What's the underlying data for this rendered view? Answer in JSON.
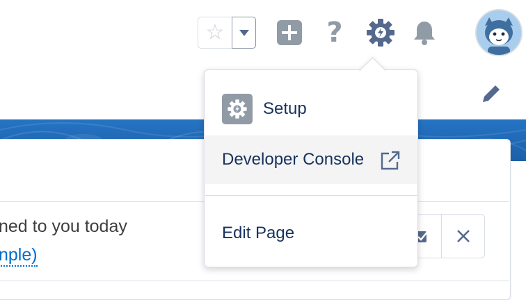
{
  "header": {
    "favorites_star_glyph": "☆",
    "icons": [
      "favorites-star-icon",
      "favorites-dropdown-icon",
      "plus-icon",
      "help-icon",
      "setup-gear-icon",
      "notifications-bell-icon",
      "avatar"
    ],
    "help_glyph": "?"
  },
  "setup_menu": {
    "items": [
      {
        "label": "Setup",
        "icon": "gear-icon"
      },
      {
        "label": "Developer Console",
        "icon": "external-link-icon"
      },
      {
        "label": "Edit Page"
      }
    ]
  },
  "content": {
    "task_text": "ned to you today",
    "task_link": "nple)"
  },
  "colors": {
    "header_icon_gray": "#919ba6",
    "blue_band": "#1f66b3",
    "link_blue": "#006dcc",
    "menu_hover_bg": "#f4f4f4"
  }
}
